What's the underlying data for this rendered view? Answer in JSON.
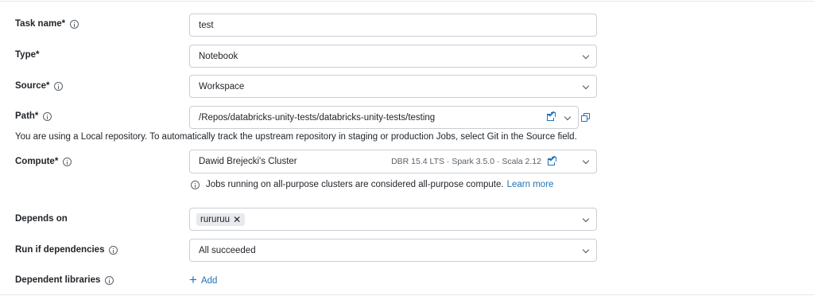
{
  "task_name": {
    "label": "Task name*",
    "value": "test"
  },
  "type": {
    "label": "Type*",
    "value": "Notebook"
  },
  "source": {
    "label": "Source*",
    "value": "Workspace"
  },
  "path": {
    "label": "Path*",
    "value": "/Repos/databricks-unity-tests/databricks-unity-tests/testing",
    "note": "You are using a Local repository. To automatically track the upstream repository in staging or production Jobs, select Git in the Source field."
  },
  "compute": {
    "label": "Compute*",
    "value": "Dawid Brejecki's Cluster",
    "meta": "DBR 15.4 LTS · Spark 3.5.0 · Scala 2.12",
    "hint": "Jobs running on all-purpose clusters are considered all-purpose compute.",
    "hint_link": "Learn more"
  },
  "depends_on": {
    "label": "Depends on",
    "tags": [
      "rururuu"
    ]
  },
  "run_if": {
    "label": "Run if dependencies",
    "value": "All succeeded"
  },
  "libraries": {
    "label": "Dependent libraries",
    "add_label": "Add"
  },
  "colors": {
    "accent": "#2272b4",
    "border": "#c9ced4",
    "text": "#1f2328"
  }
}
